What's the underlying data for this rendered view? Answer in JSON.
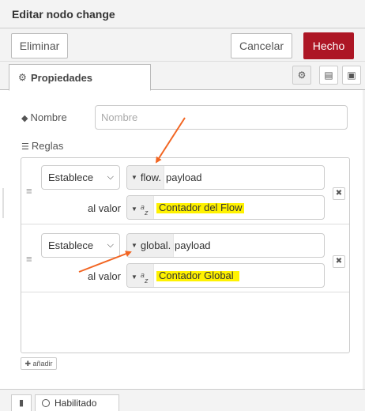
{
  "tray": {
    "title": "Editar nodo change"
  },
  "toolbar": {
    "delete_label": "Eliminar",
    "cancel_label": "Cancelar",
    "done_label": "Hecho"
  },
  "tabs": {
    "properties_label": "Propiedades"
  },
  "form": {
    "name_label": "Nombre",
    "name_placeholder": "Nombre",
    "name_value": "",
    "rules_label": "Reglas"
  },
  "rules": [
    {
      "action": "Establece",
      "target_type": "flow.",
      "target_value": "payload",
      "value_label": "al valor",
      "value_type": "string",
      "value": "Contador del Flow"
    },
    {
      "action": "Establece",
      "target_type": "global.",
      "target_value": "payload",
      "value_label": "al valor",
      "value_type": "string",
      "value": "Contador Global"
    }
  ],
  "add_label": "añadir",
  "footer": {
    "enabled_label": "Habilitado"
  },
  "colors": {
    "primary": "#ad1625",
    "highlight": "#fff200",
    "annotation_arrow": "#f26522"
  },
  "icons": [
    "gear-icon",
    "settings-icon",
    "description-icon",
    "appearance-icon",
    "tag-icon",
    "list-icon",
    "drag-handle-icon",
    "remove-icon",
    "plus-icon",
    "book-icon",
    "circle-icon",
    "caret-down-icon"
  ]
}
